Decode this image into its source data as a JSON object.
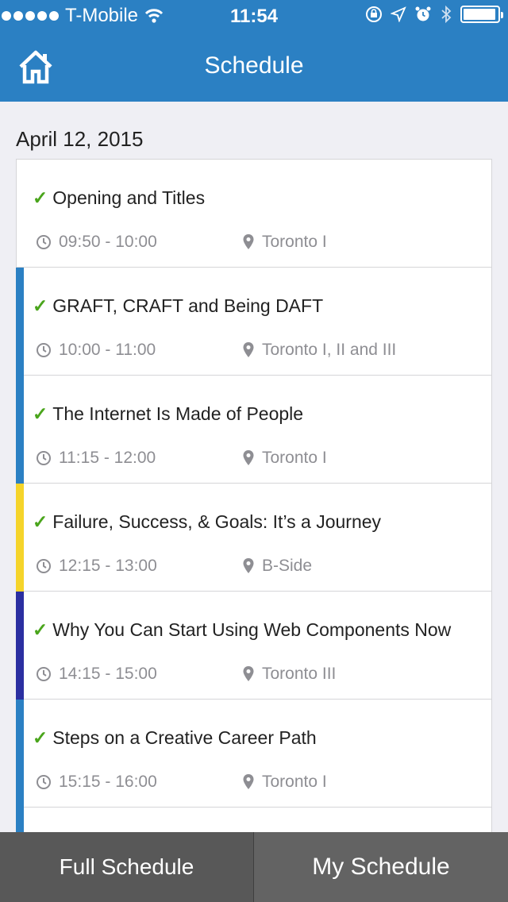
{
  "status_bar": {
    "carrier": "T-Mobile",
    "time": "11:54",
    "signal_icon": "signal-dots-icon",
    "wifi_icon": "wifi-icon",
    "battery_level": 0.95
  },
  "nav": {
    "title": "Schedule",
    "home_icon": "home-icon"
  },
  "date": "April 12, 2015",
  "colors": {
    "header": "#2b80c3",
    "check": "#4aa51c",
    "track_blue": "#2b80c3",
    "track_yellow": "#f5d42a",
    "track_indigo": "#2b2fa1"
  },
  "sessions": [
    {
      "title": "Opening and Titles",
      "time": "09:50 - 10:00",
      "location": "Toronto I",
      "track_color": ""
    },
    {
      "title": "GRAFT, CRAFT and Being DAFT",
      "time": "10:00 - 11:00",
      "location": "Toronto I, II and III",
      "track_color": "#2b80c3"
    },
    {
      "title": "The Internet Is Made of People",
      "time": "11:15 - 12:00",
      "location": "Toronto I",
      "track_color": "#2b80c3"
    },
    {
      "title": "Failure, Success, & Goals: It’s a Journey",
      "time": "12:15 - 13:00",
      "location": "B-Side",
      "track_color": "#f5d42a"
    },
    {
      "title": "Why You Can Start Using Web Components Now",
      "time": "14:15 - 15:00",
      "location": "Toronto III",
      "track_color": "#2b2fa1"
    },
    {
      "title": "Steps on a Creative Career Path",
      "time": "15:15 - 16:00",
      "location": "Toronto I",
      "track_color": "#2b80c3"
    }
  ],
  "tabs": [
    {
      "label": "Full Schedule"
    },
    {
      "label": "My Schedule"
    }
  ]
}
